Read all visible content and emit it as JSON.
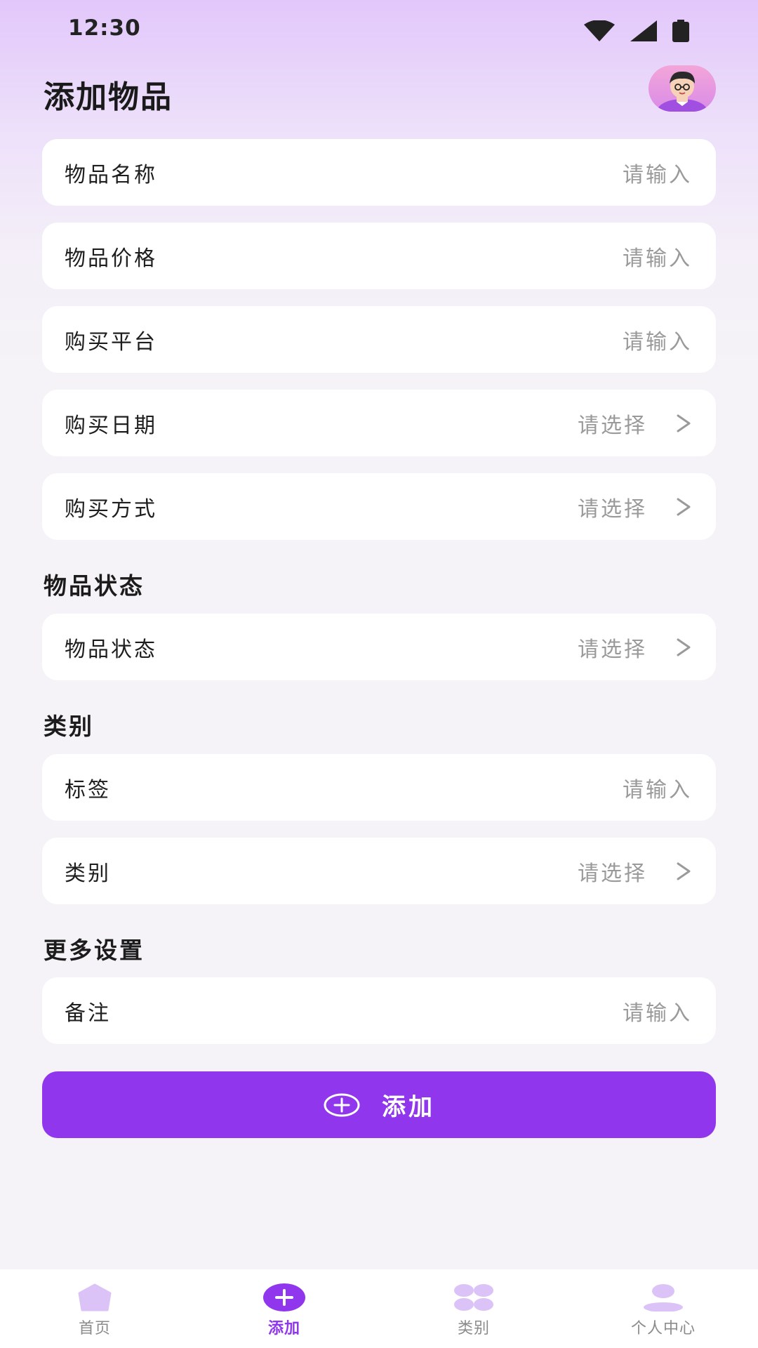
{
  "status_bar": {
    "time": "12:30"
  },
  "header": {
    "title": "添加物品"
  },
  "fields": [
    {
      "label": "物品名称",
      "value": "请输入",
      "kind": "input"
    },
    {
      "label": "物品价格",
      "value": "请输入",
      "kind": "input"
    },
    {
      "label": "购买平台",
      "value": "请输入",
      "kind": "input"
    },
    {
      "label": "购买日期",
      "value": "请选择",
      "kind": "select"
    },
    {
      "label": "购买方式",
      "value": "请选择",
      "kind": "select"
    }
  ],
  "sections": {
    "status": {
      "title": "物品状态",
      "field": {
        "label": "物品状态",
        "value": "请选择",
        "kind": "select"
      }
    },
    "category": {
      "title": "类别",
      "fields": [
        {
          "label": "标签",
          "value": "请输入",
          "kind": "input"
        },
        {
          "label": "类别",
          "value": "请选择",
          "kind": "select"
        }
      ]
    },
    "more": {
      "title": "更多设置",
      "field": {
        "label": "备注",
        "value": "请输入",
        "kind": "input"
      }
    }
  },
  "add_button": {
    "label": "添加",
    "icon": "plus-circle-icon"
  },
  "tabbar": {
    "items": [
      {
        "label": "首页",
        "icon": "home-icon",
        "active": false
      },
      {
        "label": "添加",
        "icon": "add-icon",
        "active": true
      },
      {
        "label": "类别",
        "icon": "category-icon",
        "active": false
      },
      {
        "label": "个人中心",
        "icon": "user-icon",
        "active": false
      }
    ]
  },
  "colors": {
    "accent": "#9036ed",
    "placeholder": "#9a9a9a",
    "inactive_icon": "#dcc3f7"
  }
}
